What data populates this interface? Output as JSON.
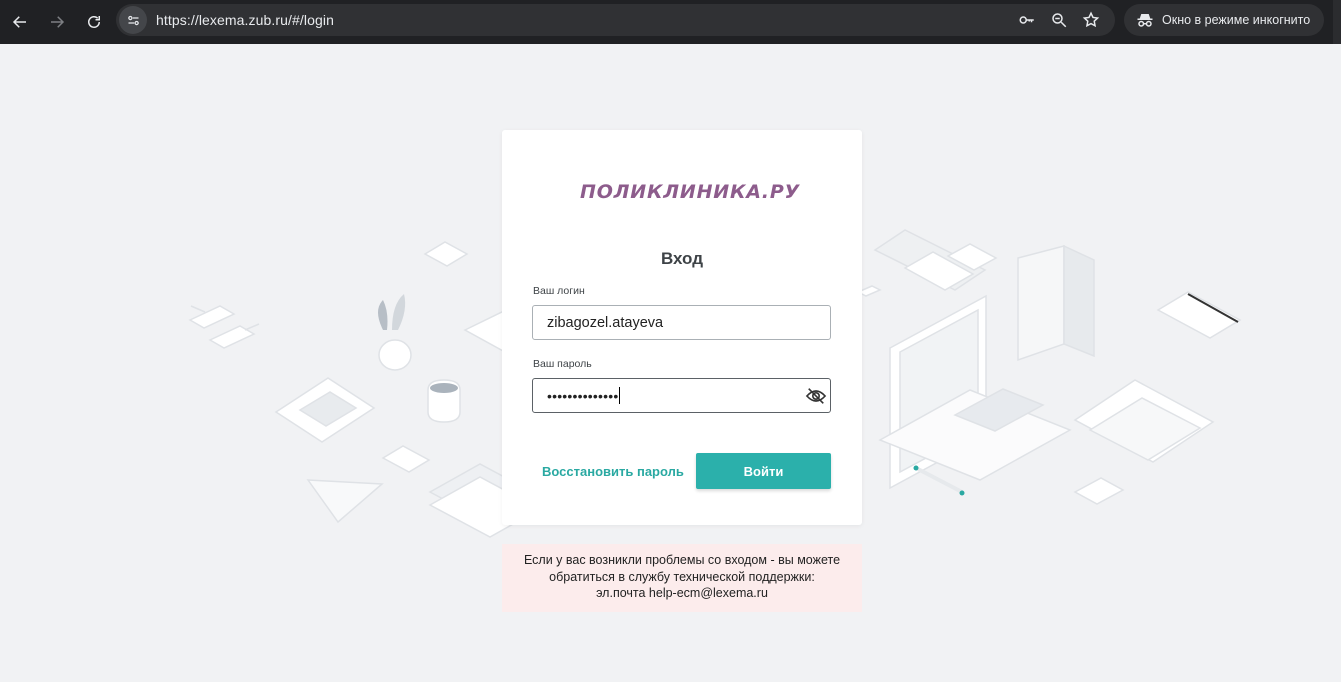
{
  "browser": {
    "url": "https://lexema.zub.ru/#/login",
    "incognito_label": "Окно в режиме инкогнито",
    "icons": [
      "back-arrow-icon",
      "forward-arrow-icon",
      "reload-icon",
      "site-info-icon",
      "password-key-icon",
      "zoom-icon",
      "bookmark-star-icon",
      "incognito-icon"
    ]
  },
  "logo": {
    "text": "ПОЛИКЛИНИКА.РУ"
  },
  "login": {
    "title": "Вход",
    "login_label": "Ваш логин",
    "login_value": "zibagozel.atayeva",
    "password_label": "Ваш пароль",
    "password_value": "••••••••••••••",
    "restore_link": "Восстановить пароль",
    "submit": "Войти"
  },
  "notice": {
    "line1": "Если у вас возникли проблемы со входом - вы можете",
    "line2": "обратиться в службу технической поддержки:",
    "line3": "эл.почта help-ecm@lexema.ru"
  },
  "colors": {
    "accent": "#2bb0ab",
    "logo": "#8d5c8c",
    "notice_bg": "#fcecec",
    "page_bg": "#f1f2f4"
  }
}
